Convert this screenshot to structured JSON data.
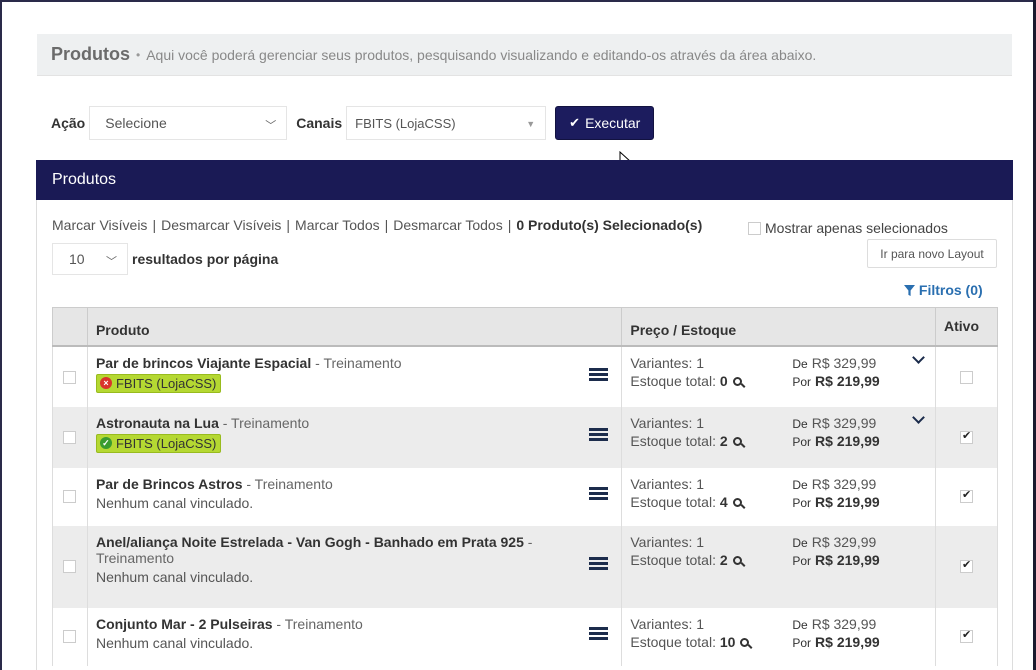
{
  "header": {
    "title": "Produtos",
    "separator": "•",
    "description": "Aqui você poderá gerenciar seus produtos, pesquisando visualizando e editando-os através da área abaixo."
  },
  "actionbar": {
    "acao_label": "Ação",
    "acao_value": "Selecione",
    "canais_label": "Canais",
    "canais_value": "FBITS (LojaCSS)",
    "execute_label": "Executar"
  },
  "panel": {
    "title": "Produtos",
    "links": [
      "Marcar Visíveis",
      "Desmarcar Visíveis",
      "Marcar Todos",
      "Desmarcar Todos"
    ],
    "selected_count": "0 Produto(s) Selecionado(s)",
    "only_selected_label": "Mostrar apenas selecionados",
    "per_page_value": "10",
    "per_page_label": "resultados por página",
    "new_layout_label": "Ir para novo Layout",
    "filters_label": "Filtros (0)"
  },
  "table": {
    "headers": {
      "product": "Produto",
      "price": "Preço / Estoque",
      "active": "Ativo"
    },
    "de_label": "De",
    "por_label": "Por",
    "variants_label": "Variantes:",
    "stock_label": "Estoque total:",
    "rows": [
      {
        "name": "Par de brincos Viajante Espacial",
        "category": " - Treinamento",
        "channel": "FBITS (LojaCSS)",
        "channel_status": "error",
        "variants": "1",
        "stock": "0",
        "price_de": "R$ 329,99",
        "price_por": "R$ 219,99",
        "active": false,
        "expand": true
      },
      {
        "name": "Astronauta na Lua",
        "category": " - Treinamento",
        "channel": "FBITS (LojaCSS)",
        "channel_status": "ok",
        "variants": "1",
        "stock": "2",
        "price_de": "R$ 329,99",
        "price_por": "R$ 219,99",
        "active": true,
        "expand": true
      },
      {
        "name": "Par de Brincos Astros",
        "category": " - Treinamento",
        "no_channel": "Nenhum canal vinculado.",
        "variants": "1",
        "stock": "4",
        "price_de": "R$ 329,99",
        "price_por": "R$ 219,99",
        "active": true
      },
      {
        "name": "Anel/aliança Noite Estrelada - Van Gogh - Banhado em Prata 925",
        "category": " - Treinamento",
        "no_channel": "Nenhum canal vinculado.",
        "variants": "1",
        "stock": "2",
        "price_de": "R$ 329,99",
        "price_por": "R$ 219,99",
        "active": true
      },
      {
        "name": "Conjunto Mar - 2 Pulseiras",
        "category": " - Treinamento",
        "no_channel": "Nenhum canal vinculado.",
        "variants": "1",
        "stock": "10",
        "price_de": "R$ 329,99",
        "price_por": "R$ 219,99",
        "active": true
      }
    ]
  },
  "colors": {
    "navy": "#1a1a55",
    "channel_badge": "#b5d832",
    "link_blue": "#2a6fb0"
  }
}
